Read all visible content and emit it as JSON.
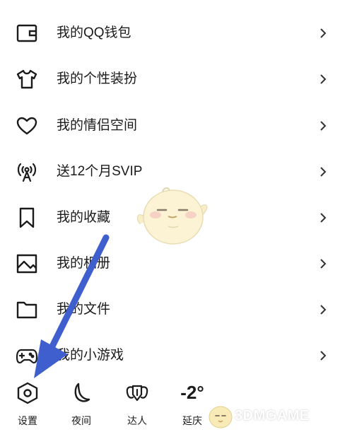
{
  "menu": {
    "items": [
      {
        "label": "我的QQ钱包",
        "icon": "wallet-icon"
      },
      {
        "label": "我的个性装扮",
        "icon": "tshirt-icon"
      },
      {
        "label": "我的情侣空间",
        "icon": "heart-icon"
      },
      {
        "label": "送12个月SVIP",
        "icon": "signal-tower-icon"
      },
      {
        "label": "我的收藏",
        "icon": "bookmark-icon"
      },
      {
        "label": "我的相册",
        "icon": "image-icon"
      },
      {
        "label": "我的文件",
        "icon": "folder-icon"
      },
      {
        "label": "我的小游戏",
        "icon": "gamepad-icon"
      }
    ],
    "chevron_icon": "chevron-right-icon"
  },
  "bottom_bar": {
    "settings_label": "设置",
    "night_label": "夜间",
    "expert_label": "达人",
    "weather_temp": "-2°",
    "weather_city": "延庆"
  },
  "watermark": {
    "text": "3DMGAME"
  },
  "colors": {
    "arrow": "#3f5fce",
    "text": "#1b1b1b",
    "icon_stroke": "#1b1b1b"
  }
}
